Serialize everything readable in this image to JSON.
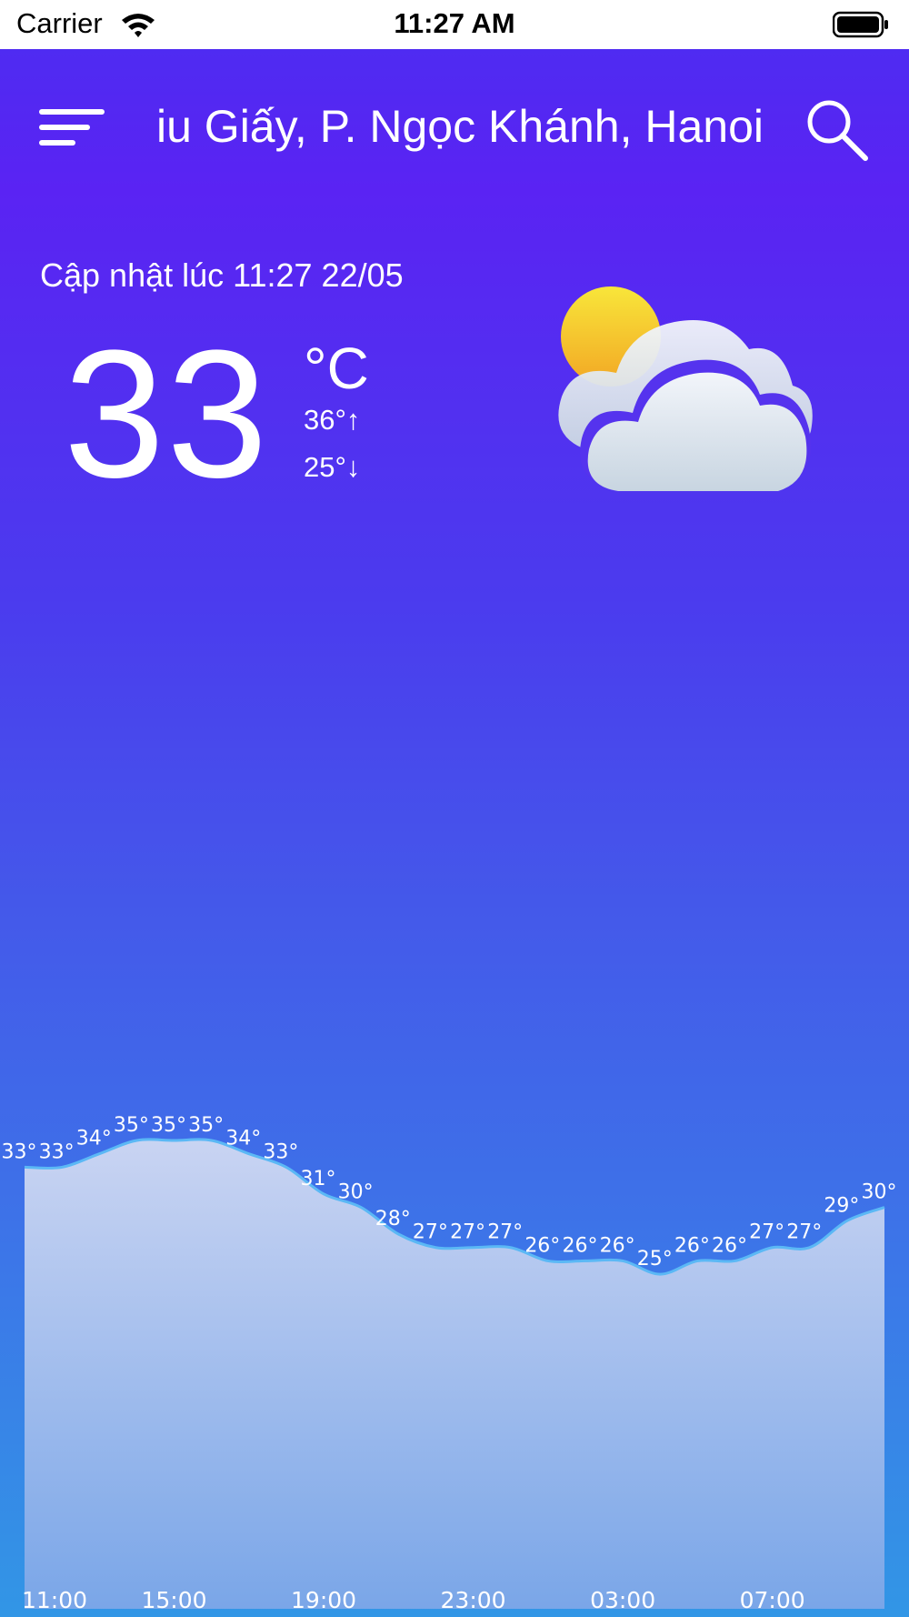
{
  "status_bar": {
    "carrier": "Carrier",
    "time": "11:27 AM",
    "icons": [
      "wifi-icon",
      "battery-icon"
    ]
  },
  "header": {
    "location": "iu Giấy, P. Ngọc Khánh, Hanoi",
    "icons": [
      "menu-icon",
      "search-icon"
    ]
  },
  "current": {
    "updated": "Cập nhật lúc 11:27 22/05",
    "temperature": "33",
    "unit": "°C",
    "high": "36°↑",
    "low": "25°↓",
    "condition_icon": "partly-cloudy-icon"
  },
  "colors": {
    "gradient_top": "#5a23f3",
    "gradient_bottom": "#3296e6",
    "area_fill_top": "#c9d4f2",
    "area_fill_bottom": "#7aa6e8",
    "line": "#5bb8f5"
  },
  "chart_data": {
    "type": "area",
    "values": [
      33,
      33,
      34,
      35,
      35,
      35,
      34,
      33,
      31,
      30,
      28,
      27,
      27,
      27,
      26,
      26,
      26,
      25,
      26,
      26,
      27,
      27,
      29,
      30
    ],
    "labels": [
      "33°",
      "33°",
      "34°",
      "35°",
      "35°",
      "35°",
      "34°",
      "33°",
      "31°",
      "30°",
      "28°",
      "27°",
      "27°",
      "27°",
      "26°",
      "26°",
      "26°",
      "25°",
      "26°",
      "26°",
      "27°",
      "27°",
      "29°",
      "30°"
    ],
    "x_ticks": [
      "11:00",
      "15:00",
      "19:00",
      "23:00",
      "03:00",
      "07:00"
    ],
    "ylim": [
      0,
      35
    ]
  }
}
